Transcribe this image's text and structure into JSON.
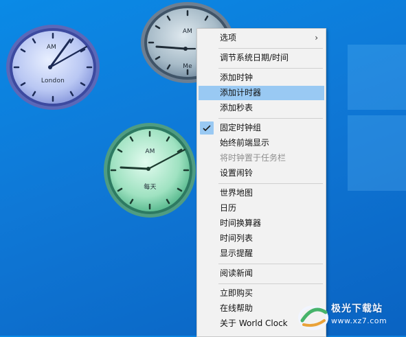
{
  "clocks": [
    {
      "id": "london",
      "am": "AM",
      "city": "London"
    },
    {
      "id": "top",
      "am": "AM",
      "city": "Me"
    },
    {
      "id": "mid",
      "am": "AM",
      "city": "每天"
    }
  ],
  "menu": {
    "items": [
      {
        "label": "选项",
        "submenu": true
      },
      {
        "label": "调节系统日期/时间"
      },
      {
        "label": "添加时钟"
      },
      {
        "label": "添加计时器",
        "highlighted": true
      },
      {
        "label": "添加秒表"
      },
      {
        "label": "固定时钟组",
        "checked": true
      },
      {
        "label": "始终前端显示"
      },
      {
        "label": "将时钟置于任务栏",
        "disabled": true
      },
      {
        "label": "设置闹铃"
      },
      {
        "label": "世界地图"
      },
      {
        "label": "日历"
      },
      {
        "label": "时间换算器"
      },
      {
        "label": "时间列表"
      },
      {
        "label": "显示提醒"
      },
      {
        "label": "阅读新闻"
      },
      {
        "label": "立即购买"
      },
      {
        "label": "在线帮助"
      },
      {
        "label": "关于 World Clock"
      }
    ],
    "submenu_arrow": "›"
  },
  "watermark": {
    "text": "极光下载站",
    "url": "www.xz7.com"
  },
  "colors": {
    "desktop": "#0f78d6",
    "menu_bg": "#f2f2f2",
    "highlight": "#99c9f3"
  }
}
